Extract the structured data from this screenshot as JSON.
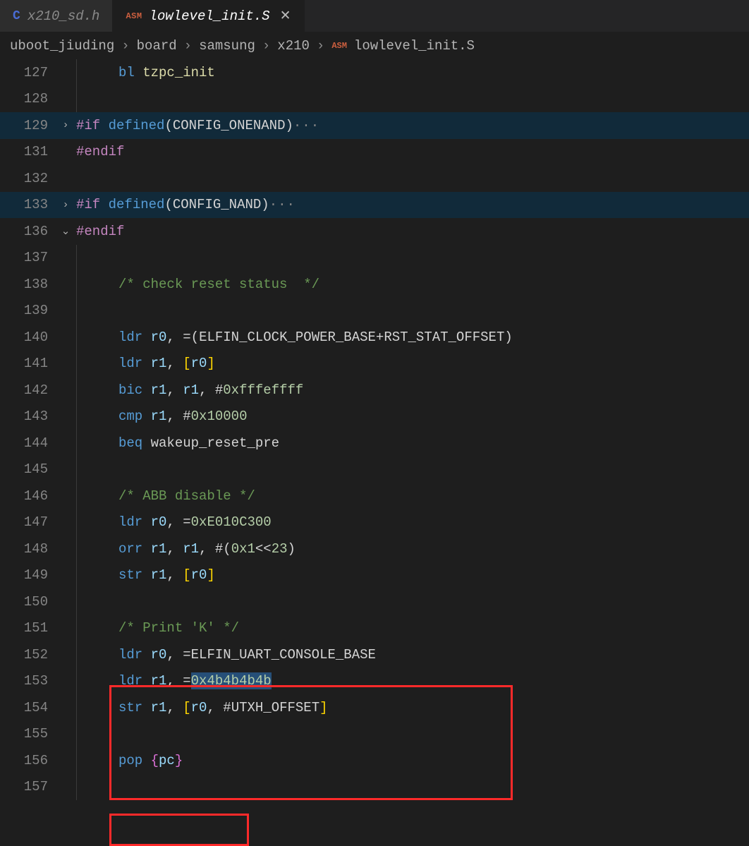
{
  "tabs": [
    {
      "lang": "C",
      "label": "x210_sd.h",
      "active": false
    },
    {
      "lang": "ASM",
      "label": "lowlevel_init.S",
      "active": true
    }
  ],
  "breadcrumb": {
    "parts": [
      "uboot_jiuding",
      "board",
      "samsung",
      "x210"
    ],
    "file_lang": "ASM",
    "file": "lowlevel_init.S",
    "sep": "›"
  },
  "code": {
    "127": {
      "indent": 2,
      "bl": "bl",
      "tzpc_init": "tzpc_init"
    },
    "128": {},
    "129": {
      "fold": ">",
      "if": "#if",
      "defined": "defined",
      "sym": "CONFIG_ONENAND",
      "ell": "···"
    },
    "131": {
      "endif": "#endif"
    },
    "132": {},
    "133": {
      "fold": ">",
      "if": "#if",
      "defined": "defined",
      "sym": "CONFIG_NAND",
      "ell": "···"
    },
    "136": {
      "fold": "v",
      "endif": "#endif"
    },
    "137": {},
    "138": {
      "indent": 2,
      "comment": "/* check reset status  */"
    },
    "139": {},
    "140": {
      "indent": 2,
      "ldr": "ldr",
      "r0": "r0",
      "eq": "=",
      "lp": "(",
      "a": "ELFIN_CLOCK_POWER_BASE",
      "plus": "+",
      "b": "RST_STAT_OFFSET",
      "rp": ")"
    },
    "141": {
      "indent": 2,
      "ldr": "ldr",
      "r1": "r1",
      "r0": "r0",
      "lb": "[",
      "rb": "]"
    },
    "142": {
      "indent": 2,
      "bic": "bic",
      "r1a": "r1",
      "r1b": "r1",
      "hash": "#",
      "num": "0xfffeffff"
    },
    "143": {
      "indent": 2,
      "cmp": "cmp",
      "r1": "r1",
      "hash": "#",
      "num": "0x10000"
    },
    "144": {
      "indent": 2,
      "beq": "beq",
      "label": "wakeup_reset_pre"
    },
    "145": {},
    "146": {
      "indent": 2,
      "comment": "/* ABB disable */"
    },
    "147": {
      "indent": 2,
      "ldr": "ldr",
      "r0": "r0",
      "eq": "=",
      "num": "0xE010C300"
    },
    "148": {
      "indent": 2,
      "orr": "orr",
      "r1a": "r1",
      "r1b": "r1",
      "hash": "#",
      "lp": "(",
      "num": "0x1",
      "shift": "<<",
      "num2": "23",
      "rp": ")"
    },
    "149": {
      "indent": 2,
      "str": "str",
      "r1": "r1",
      "r0": "r0",
      "lb": "[",
      "rb": "]"
    },
    "150": {},
    "151": {
      "indent": 2,
      "comment": "/* Print 'K' */"
    },
    "152": {
      "indent": 2,
      "ldr": "ldr",
      "r0": "r0",
      "eq": "=",
      "sym": "ELFIN_UART_CONSOLE_BASE"
    },
    "153": {
      "indent": 2,
      "ldr": "ldr",
      "r1": "r1",
      "eq": "=",
      "num": "0x4b4b4b4b"
    },
    "154": {
      "indent": 2,
      "str": "str",
      "r1": "r1",
      "lb": "[",
      "r0": "r0",
      "hash": "#",
      "sym": "UTXH_OFFSET",
      "rb": "]"
    },
    "155": {},
    "156": {
      "indent": 2,
      "pop": "pop",
      "lc": "{",
      "pc": "pc",
      "rc": "}"
    },
    "157": {}
  }
}
